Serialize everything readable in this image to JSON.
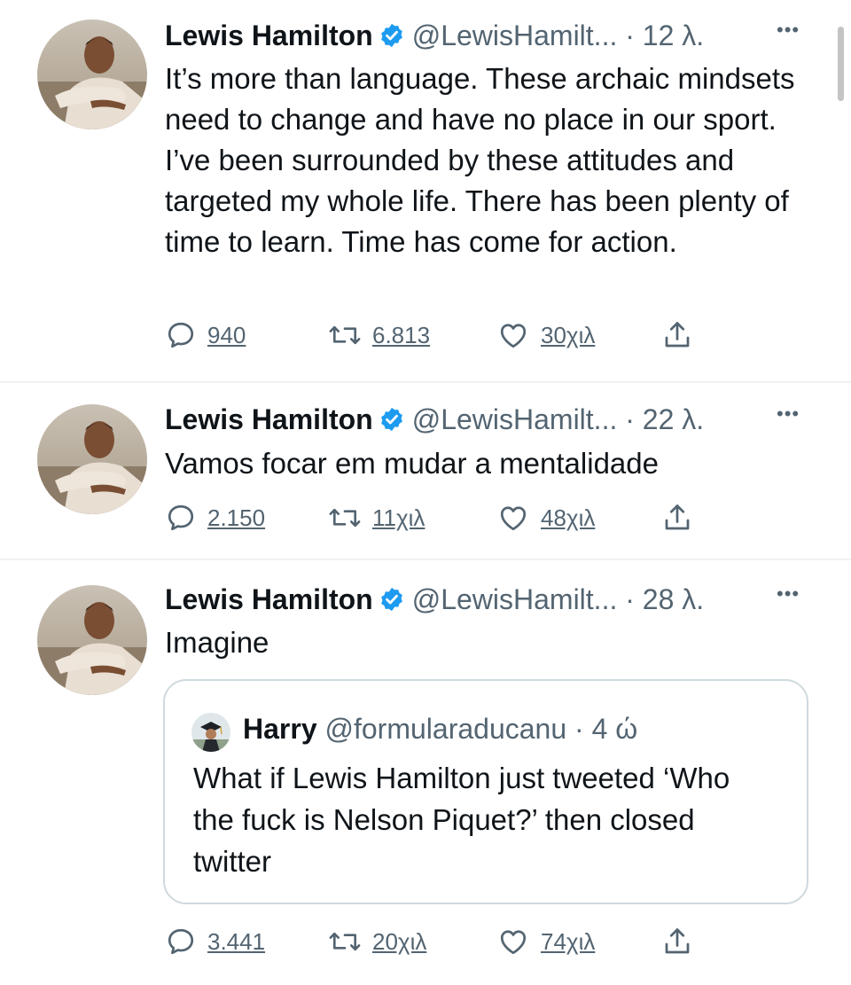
{
  "tweets": [
    {
      "name": "Lewis Hamilton",
      "handle": "@LewisHamilt...",
      "dot": "·",
      "time": "12 λ.",
      "text": "It’s more than language. These archaic mindsets need to change and have no place in our sport. I’ve been surrounded by these attitudes and targeted my whole life. There has been plenty of time to learn. Time has come for action.",
      "replies": "940",
      "retweets": "6.813",
      "likes": "30χιλ"
    },
    {
      "name": "Lewis Hamilton",
      "handle": "@LewisHamilt...",
      "dot": "·",
      "time": "22 λ.",
      "text": "Vamos focar em mudar a mentalidade",
      "replies": "2.150",
      "retweets": "11χιλ",
      "likes": "48χιλ"
    },
    {
      "name": "Lewis Hamilton",
      "handle": "@LewisHamilt...",
      "dot": "·",
      "time": "28 λ.",
      "text": "Imagine",
      "quote": {
        "name": "Harry",
        "handle": "@formularaducanu",
        "dot": "·",
        "time": "4 ώ",
        "text": "What if Lewis Hamilton just tweeted ‘Who the fuck is Nelson Piquet?’ then closed twitter"
      },
      "replies": "3.441",
      "retweets": "20χιλ",
      "likes": "74χιλ"
    }
  ],
  "more_label": "•••",
  "colors": {
    "text": "#0f1419",
    "secondary": "#536471",
    "verified": "#1d9bf0",
    "border": "#cfd9de"
  },
  "icons": [
    "reply-icon",
    "retweet-icon",
    "like-icon",
    "share-icon",
    "verified-badge-icon",
    "more-icon"
  ]
}
